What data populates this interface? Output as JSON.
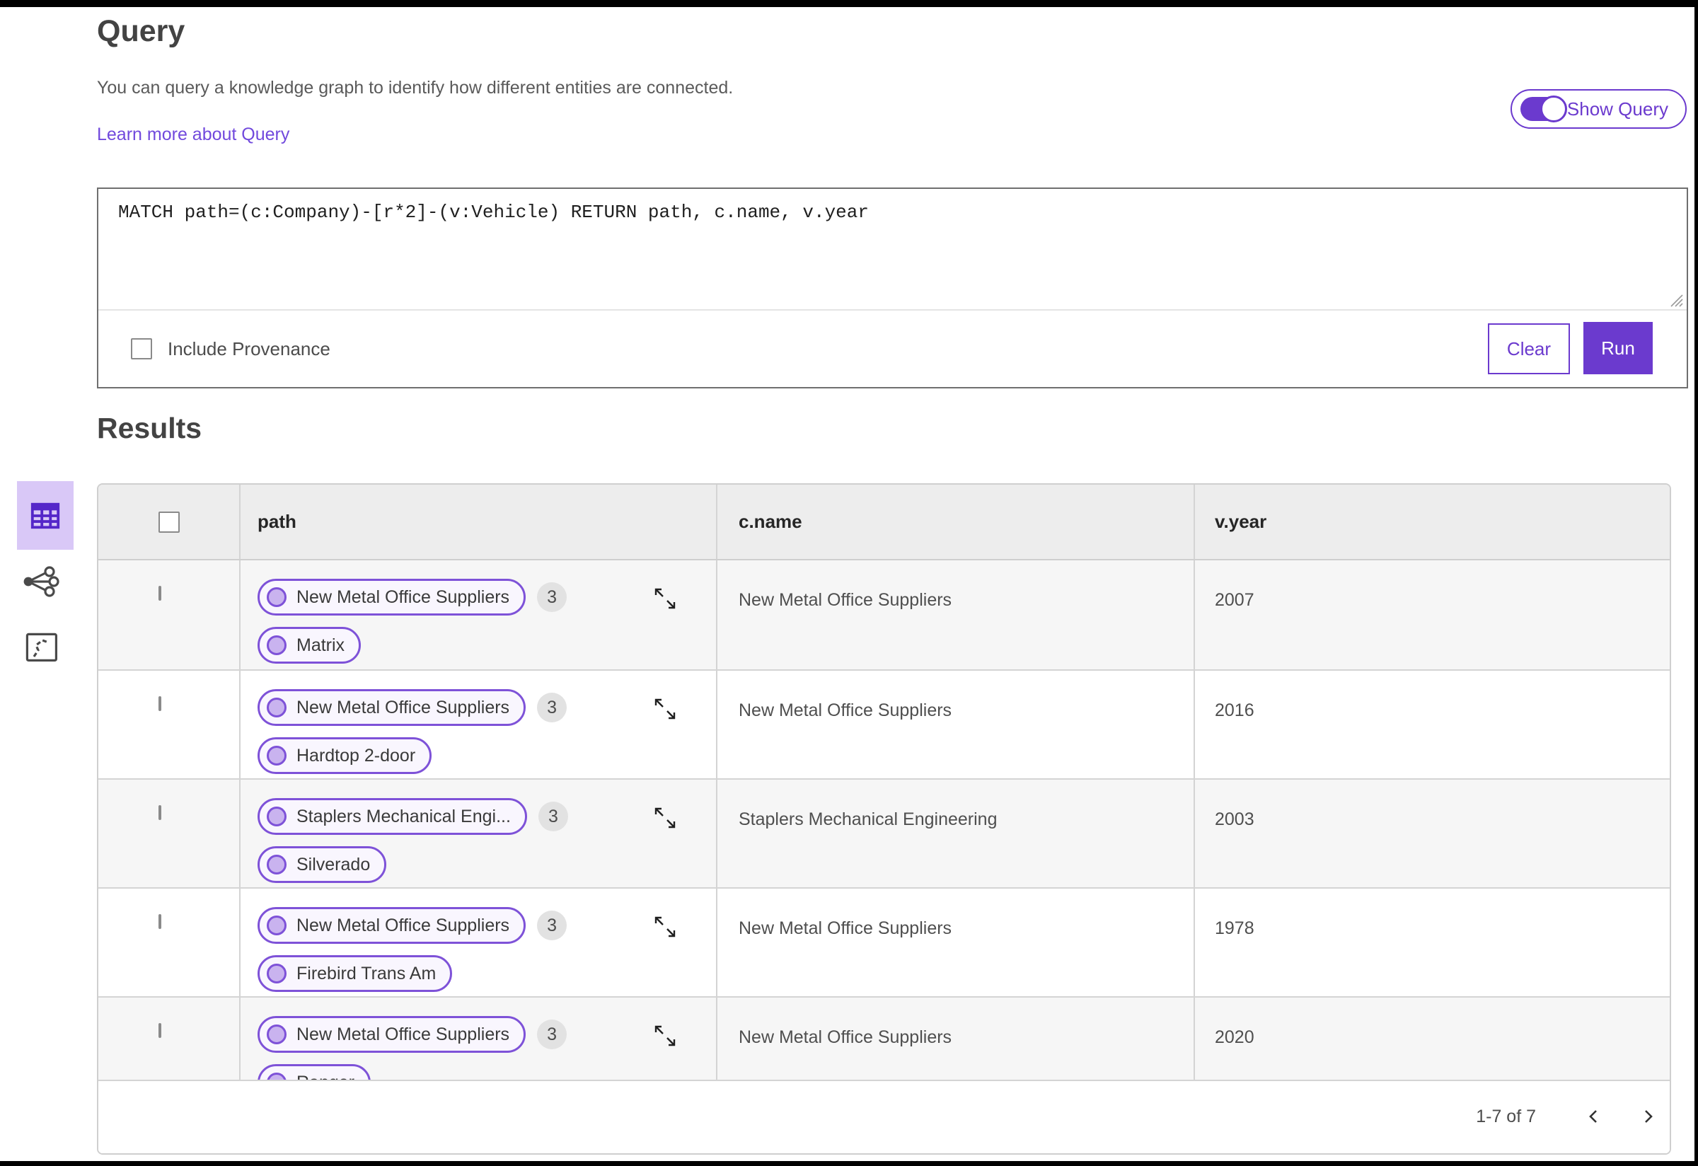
{
  "colors": {
    "accent": "#6b3ace",
    "link": "#7149dd",
    "pill_border": "#7e52d8",
    "node_fill": "#c9b3ef",
    "active_tile_bg": "#d9c8f7",
    "header_bg": "#ededed",
    "row_alt_bg": "#f6f6f6",
    "border": "#d4d4d4"
  },
  "page": {
    "title": "Query",
    "description": "You can query a knowledge graph to identify how different entities are connected.",
    "learn_more_link": "Learn more about Query",
    "show_query_label": "Show Query",
    "show_query_on": true
  },
  "query_editor": {
    "query_text": "MATCH path=(c:Company)-[r*2]-(v:Vehicle) RETURN path, c.name, v.year",
    "include_provenance_label": "Include Provenance",
    "include_provenance_checked": false,
    "clear_button_label": "Clear",
    "run_button_label": "Run"
  },
  "results": {
    "title": "Results",
    "view_switcher": [
      {
        "name": "table-view",
        "icon": "table-icon",
        "active": true
      },
      {
        "name": "graph-view",
        "icon": "graph-icon",
        "active": false
      },
      {
        "name": "map-view",
        "icon": "map-icon",
        "active": false
      }
    ],
    "table": {
      "columns": [
        "path",
        "c.name",
        "v.year"
      ],
      "rows": [
        {
          "path": {
            "nodes": [
              "New Metal Office Suppliers",
              "Matrix"
            ],
            "count": "3"
          },
          "c_name": "New Metal Office Suppliers",
          "v_year": "2007"
        },
        {
          "path": {
            "nodes": [
              "New Metal Office Suppliers",
              "Hardtop 2-door"
            ],
            "count": "3"
          },
          "c_name": "New Metal Office Suppliers",
          "v_year": "2016"
        },
        {
          "path": {
            "nodes": [
              "Staplers Mechanical Engi...",
              "Silverado"
            ],
            "count": "3"
          },
          "c_name": "Staplers Mechanical Engineering",
          "v_year": "2003"
        },
        {
          "path": {
            "nodes": [
              "New Metal Office Suppliers",
              "Firebird Trans Am"
            ],
            "count": "3"
          },
          "c_name": "New Metal Office Suppliers",
          "v_year": "1978"
        },
        {
          "path": {
            "nodes": [
              "New Metal Office Suppliers",
              "Ranger"
            ],
            "count": "3"
          },
          "c_name": "New Metal Office Suppliers",
          "v_year": "2020"
        }
      ]
    },
    "pagination": {
      "range_label": "1-7 of 7"
    }
  }
}
